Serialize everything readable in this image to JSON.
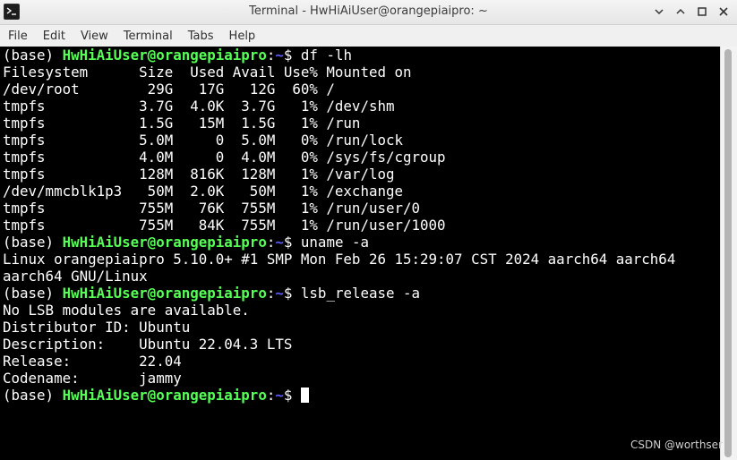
{
  "window": {
    "title": "Terminal - HwHiAiUser@orangepiaipro: ~",
    "minimize_icon": "chevron-down-icon",
    "restore_icon": "chevron-up-icon",
    "maximize_icon": "square-icon",
    "close_icon": "close-icon"
  },
  "menu": [
    "File",
    "Edit",
    "View",
    "Terminal",
    "Tabs",
    "Help"
  ],
  "prompt": {
    "env": "(base) ",
    "user": "HwHiAiUser@orangepiaipro",
    "sep": ":",
    "path": "~",
    "sym": "$ "
  },
  "lines": [
    {
      "type": "prompt",
      "cmd": "df -lh"
    },
    {
      "type": "out",
      "text": "Filesystem      Size  Used Avail Use% Mounted on"
    },
    {
      "type": "out",
      "text": "/dev/root        29G   17G   12G  60% /"
    },
    {
      "type": "out",
      "text": "tmpfs           3.7G  4.0K  3.7G   1% /dev/shm"
    },
    {
      "type": "out",
      "text": "tmpfs           1.5G   15M  1.5G   1% /run"
    },
    {
      "type": "out",
      "text": "tmpfs           5.0M     0  5.0M   0% /run/lock"
    },
    {
      "type": "out",
      "text": "tmpfs           4.0M     0  4.0M   0% /sys/fs/cgroup"
    },
    {
      "type": "out",
      "text": "tmpfs           128M  816K  128M   1% /var/log"
    },
    {
      "type": "out",
      "text": "/dev/mmcblk1p3   50M  2.0K   50M   1% /exchange"
    },
    {
      "type": "out",
      "text": "tmpfs           755M   76K  755M   1% /run/user/0"
    },
    {
      "type": "out",
      "text": "tmpfs           755M   84K  755M   1% /run/user/1000"
    },
    {
      "type": "prompt",
      "cmd": "uname -a"
    },
    {
      "type": "out",
      "text": "Linux orangepiaipro 5.10.0+ #1 SMP Mon Feb 26 15:29:07 CST 2024 aarch64 aarch64"
    },
    {
      "type": "out",
      "text": "aarch64 GNU/Linux"
    },
    {
      "type": "prompt",
      "cmd": "lsb_release -a"
    },
    {
      "type": "out",
      "text": "No LSB modules are available."
    },
    {
      "type": "out",
      "text": "Distributor ID: Ubuntu"
    },
    {
      "type": "out",
      "text": "Description:    Ubuntu 22.04.3 LTS"
    },
    {
      "type": "out",
      "text": "Release:        22.04"
    },
    {
      "type": "out",
      "text": "Codename:       jammy"
    },
    {
      "type": "prompt",
      "cmd": "",
      "cursor": true
    }
  ],
  "watermark": "CSDN @worthser",
  "colors": {
    "background": "#000000",
    "text": "#ffffff",
    "user": "#55ff55",
    "path": "#5c5cff"
  }
}
